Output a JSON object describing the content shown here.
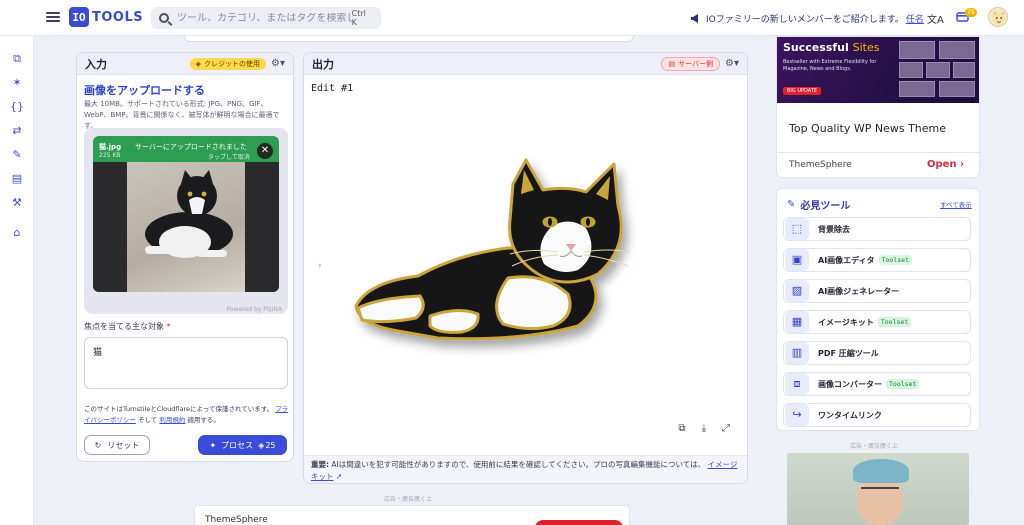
{
  "header": {
    "logo_badge": "IO",
    "logo_text": "TOOLS",
    "search_placeholder": "ツール、カテゴリ、またはタグを検索し...",
    "search_shortcut": "Ctrl K",
    "announcement": "IOファミリーの新しいメンバーをご紹介します。",
    "announcement_link": "任名",
    "lang_icon": "translate-icon",
    "credits_badge": "75"
  },
  "rail": {
    "icons": [
      "copy-icon",
      "magic-wand-icon",
      "braces-icon",
      "convert-icon",
      "edit-icon",
      "document-icon",
      "wrench-icon",
      "tag-icon"
    ]
  },
  "input_panel": {
    "title": "入力",
    "credit_chip": "クレジットの使用",
    "upload_title": "画像をアップロードする",
    "upload_desc": "最大 10MB。サポートされている形式: JPG、PNG、GIF、WebP、BMP。背景に関係なく、被写体が鮮明な場合に最適です。",
    "file": {
      "name": "猫.jpg",
      "size": "225 KB",
      "status": "サーバーにアップロードされました",
      "hint": "タップして取消"
    },
    "powered_by": "Powered by PQINA",
    "focus_label": "焦点を当てる主な対象",
    "focus_required": "*",
    "focus_value": "猫",
    "notice_prefix": "このサイトはTurnstileとCloudflareによって保護されています。",
    "notice_link1": "プライバシーポリシー",
    "notice_mid": "そして",
    "notice_link2": "利用規約",
    "notice_suffix": "適用する。",
    "reset_label": "リセット",
    "process_label": "プロセス",
    "process_cost": "25"
  },
  "output_panel": {
    "title": "出力",
    "server_chip": "サーバー側",
    "edit_label": "Edit #1",
    "disclaimer_bold": "重要:",
    "disclaimer_text": "AIは間違いを犯す可能性がありますので、使用前に結果を確認してください。プロの写真編集機能については、",
    "disclaimer_link": "イメージキット",
    "tools": [
      "copy-icon",
      "download-icon",
      "fullscreen-icon"
    ]
  },
  "ads": {
    "note": "広告・廣告廣く上",
    "bottom_brand": "ThemeSphere",
    "right_head_bold": "Successful",
    "right_head_accent": "Sites",
    "right_sub": "Bestseller with Extreme Flexibility for Magazine, News and Blogs.",
    "right_badge": "BIG UPDATE",
    "right_main": "Top Quality WP News Theme",
    "right_brand": "ThemeSphere",
    "right_open": "Open"
  },
  "tools_card": {
    "title": "必見ツール",
    "see_all": "すべて表示",
    "items": [
      {
        "label": "背景除去",
        "tag": ""
      },
      {
        "label": "AI画像エディタ",
        "tag": "Toolset"
      },
      {
        "label": "AI画像ジェネレーター",
        "tag": ""
      },
      {
        "label": "イメージキット",
        "tag": "Toolset"
      },
      {
        "label": "PDF 圧縮ツール",
        "tag": ""
      },
      {
        "label": "画像コンバーター",
        "tag": "Toolset"
      },
      {
        "label": "ワンタイムリンク",
        "tag": ""
      }
    ]
  },
  "colors": {
    "primary": "#3a4bd8",
    "accent_green": "#2d9d51",
    "danger": "#d62c3a",
    "credit_yellow": "#ffd84d"
  }
}
